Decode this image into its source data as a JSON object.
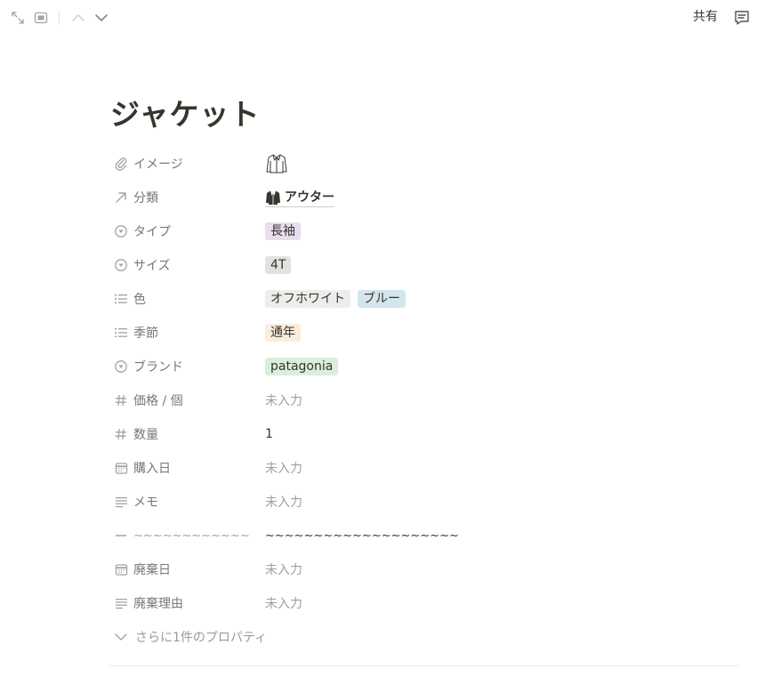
{
  "topbar": {
    "share_label": "共有"
  },
  "page": {
    "title": "ジャケット"
  },
  "properties": [
    {
      "key": "image",
      "name": "イメージ",
      "icon": "paperclip-icon"
    },
    {
      "key": "category",
      "name": "分類",
      "icon": "arrow-up-right-icon",
      "value": "アウター"
    },
    {
      "key": "type",
      "name": "タイプ",
      "icon": "select-icon",
      "value": "長袖"
    },
    {
      "key": "size",
      "name": "サイズ",
      "icon": "select-icon",
      "value": "4T"
    },
    {
      "key": "color",
      "name": "色",
      "icon": "list-icon",
      "values": [
        "オフホワイト",
        "ブルー"
      ]
    },
    {
      "key": "season",
      "name": "季節",
      "icon": "list-icon",
      "value": "通年"
    },
    {
      "key": "brand",
      "name": "ブランド",
      "icon": "select-icon",
      "value": "patagonia"
    },
    {
      "key": "price",
      "name": "価格 / 個",
      "icon": "hash-icon",
      "value": "未入力"
    },
    {
      "key": "quantity",
      "name": "数量",
      "icon": "hash-icon",
      "value": "1"
    },
    {
      "key": "purchase_date",
      "name": "購入日",
      "icon": "calendar-icon",
      "value": "未入力"
    },
    {
      "key": "memo",
      "name": "メモ",
      "icon": "text-icon",
      "value": "未入力"
    },
    {
      "key": "separator",
      "name": "~~~~~~~~~~~~",
      "icon": "dash-icon",
      "value": "~~~~~~~~~~~~~~~~~~~~"
    },
    {
      "key": "disposal_date",
      "name": "廃棄日",
      "icon": "calendar-icon",
      "value": "未入力"
    },
    {
      "key": "disposal_reason",
      "name": "廃棄理由",
      "icon": "text-icon",
      "value": "未入力"
    }
  ],
  "more_properties_label": "さらに1件のプロパティ",
  "colors": {
    "tag_purple": "#e8deee",
    "tag_gray": "#e3e2e0",
    "tag_light": "#eeedeb",
    "tag_blue": "#d3e5ef",
    "tag_orange": "#fbecdd",
    "tag_green": "#dbeddb",
    "muted_text": "#a19f9a"
  }
}
